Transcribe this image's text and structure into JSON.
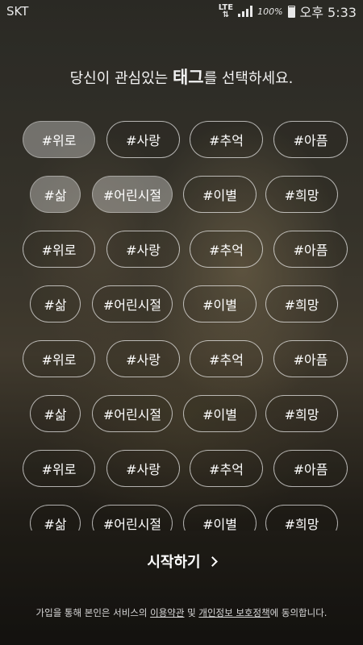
{
  "status": {
    "carrier": "SKT",
    "network": "LTE",
    "battery": "100%",
    "time": "오후 5:33"
  },
  "heading": {
    "before": "당신이 관심있는 ",
    "emphasis": "태그",
    "after": "를 선택하세요."
  },
  "rows": [
    [
      "#위로",
      "#사랑",
      "#추억",
      "#아픔"
    ],
    [
      "#삶",
      "#어린시절",
      "#이별",
      "#희망"
    ],
    [
      "#위로",
      "#사랑",
      "#추억",
      "#아픔"
    ],
    [
      "#삶",
      "#어린시절",
      "#이별",
      "#희망"
    ],
    [
      "#위로",
      "#사랑",
      "#추억",
      "#아픔"
    ],
    [
      "#삶",
      "#어린시절",
      "#이별",
      "#희망"
    ],
    [
      "#위로",
      "#사랑",
      "#추억",
      "#아픔"
    ],
    [
      "#삶",
      "#어린시절",
      "#이별",
      "#희망"
    ]
  ],
  "selected_tags": [
    "row0-0",
    "row1-0",
    "row1-1"
  ],
  "start_label": "시작하기",
  "footer": {
    "prefix": "가입을 통해 본인은 서비스의 ",
    "terms": "이용약관",
    "and": " 및 ",
    "privacy": "개인정보 보호정책",
    "suffix": "에 동의합니다."
  }
}
